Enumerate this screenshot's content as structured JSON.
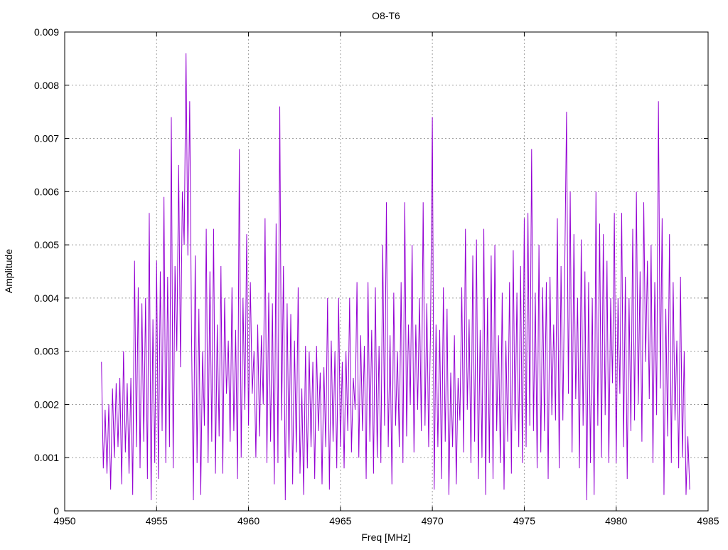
{
  "chart_data": {
    "type": "line",
    "title": "O8-T6",
    "xlabel": "Freq [MHz]",
    "ylabel": "Amplitude",
    "xlim": [
      4950,
      4985
    ],
    "ylim": [
      0,
      0.009
    ],
    "xticks": [
      "4950",
      "4955",
      "4960",
      "4965",
      "4970",
      "4975",
      "4980",
      "4985"
    ],
    "yticks": [
      "0",
      "0.001",
      "0.002",
      "0.003",
      "0.004",
      "0.005",
      "0.006",
      "0.007",
      "0.008",
      "0.009"
    ],
    "grid": true,
    "series_color": "#9400D3",
    "x_start": 4952.0,
    "x_step": 0.1,
    "y_multiplier": 0.001,
    "series": [
      {
        "name": "O8-T6",
        "values": [
          2.8,
          0.8,
          1.9,
          0.7,
          2.0,
          0.4,
          2.3,
          1.0,
          2.4,
          1.2,
          2.5,
          0.5,
          3.0,
          1.1,
          2.4,
          0.7,
          2.5,
          0.3,
          4.7,
          1.2,
          4.2,
          0.8,
          3.9,
          1.3,
          4.0,
          0.6,
          5.6,
          0.2,
          3.6,
          0.9,
          4.7,
          0.6,
          4.5,
          1.5,
          5.9,
          0.9,
          4.4,
          1.2,
          7.4,
          0.8,
          4.6,
          3.0,
          6.5,
          2.7,
          6.0,
          5.0,
          8.6,
          4.8,
          7.7,
          3.3,
          0.2,
          4.8,
          0.9,
          3.8,
          0.3,
          3.0,
          1.6,
          5.3,
          0.9,
          4.5,
          1.3,
          5.3,
          0.7,
          3.5,
          1.4,
          4.6,
          0.7,
          4.0,
          2.2,
          3.2,
          1.3,
          4.2,
          1.5,
          3.4,
          0.6,
          6.8,
          1.0,
          4.0,
          1.9,
          5.2,
          1.6,
          4.3,
          2.2,
          3.0,
          1.0,
          3.5,
          1.4,
          3.3,
          2.0,
          5.5,
          0.9,
          4.1,
          1.3,
          3.9,
          0.5,
          5.4,
          0.9,
          7.6,
          1.7,
          4.6,
          0.2,
          3.9,
          1.0,
          3.7,
          0.5,
          3.2,
          1.1,
          4.2,
          0.7,
          2.3,
          0.3,
          3.1,
          0.8,
          3.0,
          1.2,
          2.8,
          0.6,
          3.1,
          1.5,
          2.6,
          0.5,
          2.7,
          1.2,
          4.0,
          0.4,
          3.2,
          1.3,
          3.0,
          0.8,
          4.0,
          1.2,
          2.8,
          0.8,
          3.0,
          1.5,
          4.0,
          1.1,
          2.5,
          1.9,
          4.3,
          1.0,
          3.3,
          1.5,
          3.1,
          0.6,
          4.3,
          1.3,
          3.4,
          0.7,
          4.2,
          1.0,
          3.1,
          0.9,
          5.0,
          1.6,
          5.8,
          1.2,
          3.3,
          0.5,
          4.1,
          1.6,
          3.0,
          1.2,
          4.3,
          0.9,
          5.8,
          1.4,
          3.5,
          2.0,
          5.0,
          1.1,
          3.5,
          1.9,
          4.0,
          1.5,
          5.8,
          1.6,
          3.9,
          1.2,
          3.4,
          7.4,
          0.4,
          3.5,
          1.2,
          3.4,
          0.6,
          4.2,
          1.3,
          3.8,
          0.3,
          2.6,
          1.2,
          3.3,
          0.5,
          2.5,
          1.7,
          4.2,
          1.1,
          5.3,
          1.9,
          3.6,
          0.9,
          4.8,
          1.3,
          5.1,
          0.6,
          3.4,
          1.0,
          5.3,
          0.3,
          4.0,
          0.9,
          4.8,
          0.6,
          5.0,
          1.5,
          3.3,
          0.9,
          4.1,
          0.4,
          3.2,
          1.3,
          4.3,
          0.7,
          4.9,
          1.5,
          4.1,
          1.2,
          4.6,
          0.9,
          5.5,
          1.2,
          5.6,
          1.6,
          6.8,
          1.5,
          4.1,
          0.8,
          5.0,
          1.1,
          4.2,
          1.5,
          4.3,
          0.6,
          4.4,
          1.8,
          3.5,
          1.7,
          5.5,
          0.8,
          4.6,
          1.7,
          4.5,
          7.5,
          2.2,
          6.0,
          1.1,
          5.2,
          2.1,
          4.0,
          0.8,
          5.1,
          1.6,
          4.5,
          0.2,
          4.3,
          0.9,
          4.0,
          0.3,
          6.0,
          1.6,
          5.4,
          1.0,
          5.2,
          1.8,
          4.7,
          0.9,
          4.0,
          2.4,
          5.6,
          0.9,
          4.0,
          2.2,
          5.6,
          1.2,
          4.4,
          0.6,
          4.0,
          1.5,
          5.3,
          1.7,
          6.0,
          2.0,
          4.5,
          1.3,
          5.8,
          2.8,
          4.7,
          2.1,
          5.0,
          0.9,
          4.3,
          1.8,
          7.7,
          2.3,
          5.5,
          0.3,
          3.8,
          1.4,
          5.2,
          0.9,
          4.3,
          1.7,
          3.2,
          0.8,
          4.4,
          1.0,
          3.0,
          0.3,
          1.4,
          0.4
        ]
      }
    ]
  }
}
